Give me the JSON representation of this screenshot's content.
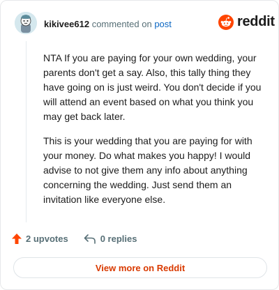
{
  "comment": {
    "username": "kikivee612",
    "action_text": "commented on",
    "post_link_label": "post",
    "body_paragraphs": [
      "NTA If you are paying for your own wedding, your parents don't get a say. Also, this tally thing they have going on is just weird. You don't decide if you will attend an event based on what you think you may get back later.",
      "This is your wedding that you are paying for with your money. Do what makes you happy! I would advise to not give them any info about anything concerning the wedding. Just send them an invitation like everyone else."
    ]
  },
  "brand": {
    "name": "reddit",
    "icon": "reddit-snoo-icon",
    "color": "#ff4500"
  },
  "footer": {
    "upvotes_label": "2 upvotes",
    "upvote_icon": "upvote-arrow-icon",
    "upvote_color": "#ff4500",
    "replies_label": "0 replies",
    "reply_icon": "reply-arrow-icon",
    "view_more_label": "View more on Reddit",
    "view_more_color": "#d93a00"
  }
}
